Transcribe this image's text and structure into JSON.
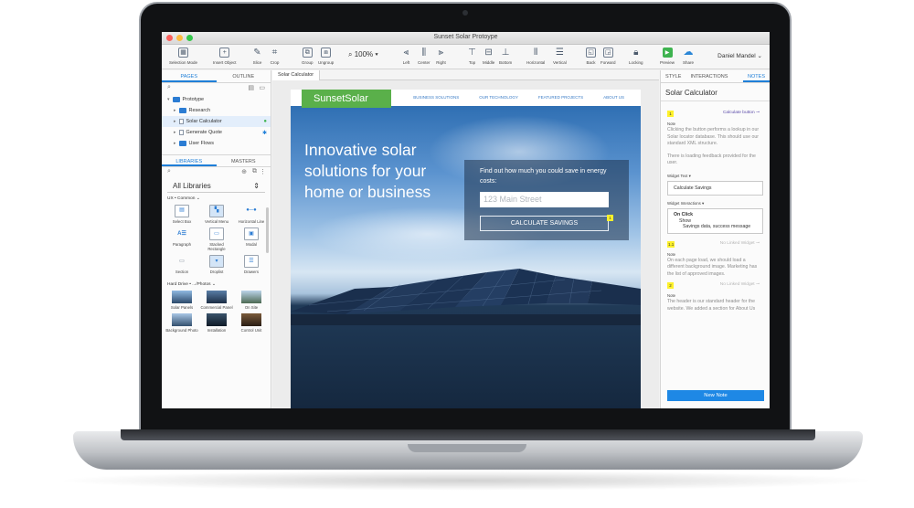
{
  "window": {
    "title": "Sunset Solar Protoype"
  },
  "toolbar": {
    "selection_mode": "Selection Mode",
    "insert_object": "Insert Object",
    "slice": "Slice",
    "crop": "Crop",
    "group": "Group",
    "ungroup": "Ungroup",
    "zoom": "100%",
    "left": "Left",
    "center": "Center",
    "right": "Right",
    "top": "Top",
    "middle": "Middle",
    "bottom": "Bottom",
    "horizontal": "Horizontal",
    "vertical": "Vertical",
    "back": "Back",
    "forward": "Forward",
    "locking": "Locking",
    "preview": "Preview",
    "share": "Share",
    "user": "Daniel Mandel"
  },
  "left_panel": {
    "tabs": [
      "PAGES",
      "OUTLINE"
    ],
    "tree": [
      {
        "label": "Prototype"
      },
      {
        "label": "Research"
      },
      {
        "label": "Solar Calculator"
      },
      {
        "label": "Generate Quote"
      },
      {
        "label": "User Flows"
      }
    ],
    "lib_tabs": [
      "LIBRARIES",
      "MASTERS"
    ],
    "library_select": "All Libraries",
    "section1": "UX • Common",
    "widgets": [
      {
        "label": "Select Box"
      },
      {
        "label": "Vertical Menu"
      },
      {
        "label": "Horizontal Line"
      },
      {
        "label": "Paragraph"
      },
      {
        "label": "Stacked Rectangle"
      },
      {
        "label": "Modal"
      },
      {
        "label": "Section"
      },
      {
        "label": "Droplist"
      },
      {
        "label": "Drawers"
      }
    ],
    "section2": "Hard Drive • .../Photos",
    "photos": [
      {
        "label": "Solar Panels"
      },
      {
        "label": "Commercial Panel"
      },
      {
        "label": "On Site"
      },
      {
        "label": "Background Photo"
      },
      {
        "label": "Installation"
      },
      {
        "label": "Control Unit"
      }
    ]
  },
  "canvas": {
    "tab": "Solar Calculator",
    "site": {
      "logo": "SunsetSolar",
      "nav": [
        "BUSINESS SOLUTIONS",
        "OUR TECHNOLOGY",
        "FEATURED PROJECTS",
        "ABOUT US"
      ],
      "headline": "Innovative solar solutions for your home or business",
      "cta_text": "Find out how much you could save in energy costs:",
      "cta_placeholder": "123 Main Street",
      "cta_button": "CALCULATE SAVINGS",
      "cta_badge": "1"
    }
  },
  "right_panel": {
    "tabs": [
      "STYLE",
      "INTERACTIONS",
      "NOTES"
    ],
    "title": "Solar Calculator",
    "note1": {
      "badge": "1",
      "link": "Calculate button",
      "label": "Note",
      "text": "Clicking the button performs a lookup in our Solar locator database. This should use our standard XML structure.",
      "text2": "There is loading feedback provided for the user.",
      "widget_text_label": "Widget Text",
      "widget_text": "Calculate Savings",
      "interactions_label": "Widget Interactions",
      "on_click": "On Click",
      "show": "Show",
      "show_detail": "Savings data, success message"
    },
    "note2": {
      "badge": "1.1",
      "link": "No Linked Widget",
      "label": "Note",
      "text": "On each page load, we should load a different background image. Marketing has the list of approved images."
    },
    "note3": {
      "badge": "2",
      "link": "No Linked Widget",
      "label": "Note",
      "text": "The header is our standard header for the website. We added a section for About Us"
    },
    "new_note": "New Note"
  },
  "colors": {
    "accent": "#1f7fd8",
    "brand_green": "#5ab04a",
    "badge_yellow": "#fef12b"
  }
}
